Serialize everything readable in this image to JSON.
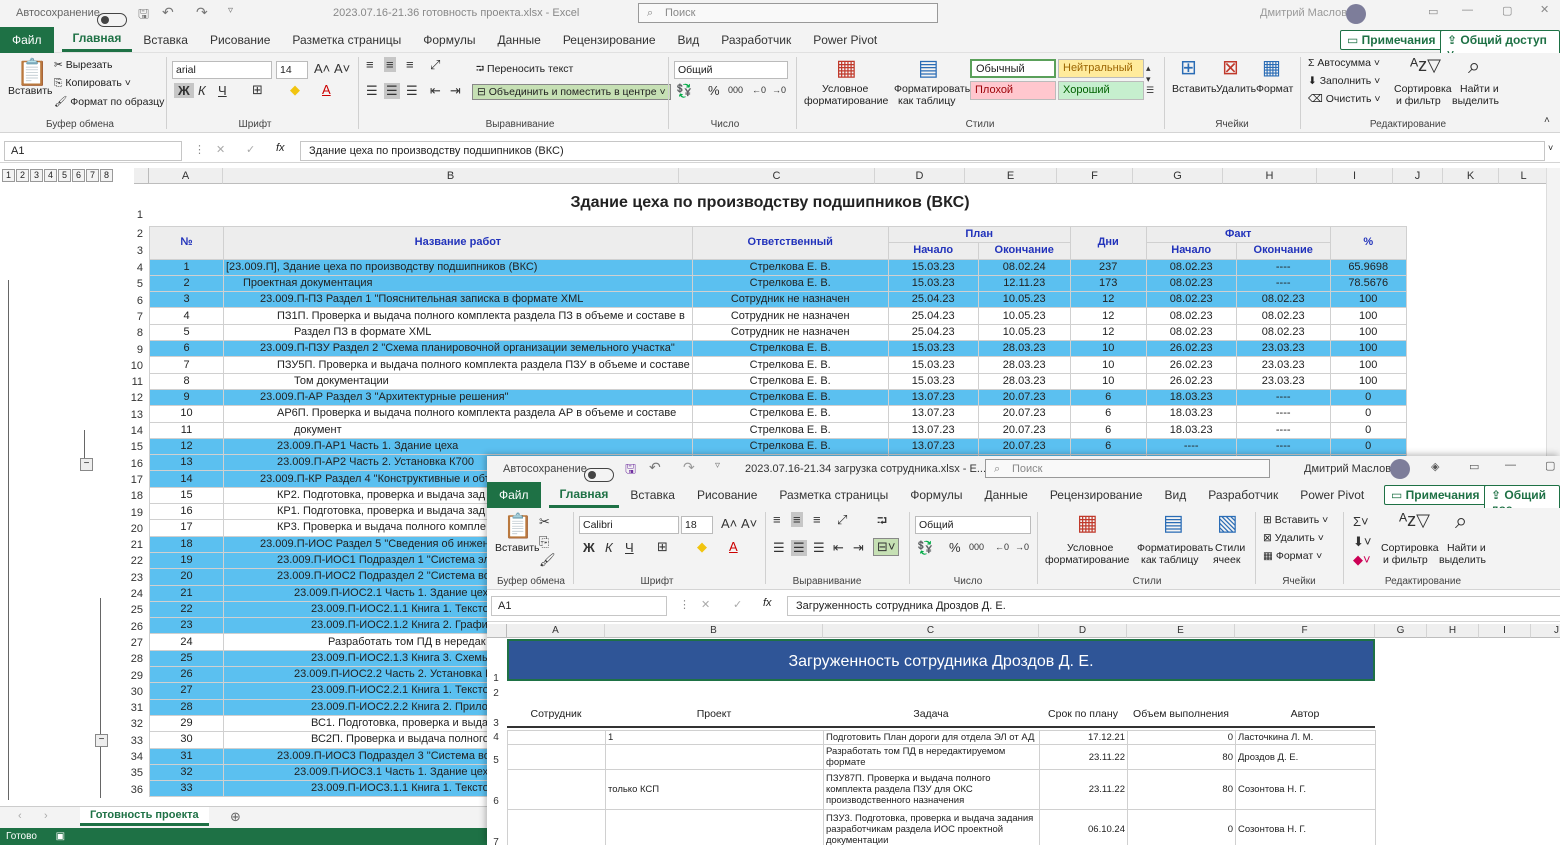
{
  "win1": {
    "autosave_label": "Автосохранение",
    "doc_title": "2023.07.16-21.36 готовность проекта.xlsx  -  Excel",
    "search_placeholder": "Поиск",
    "user_name": "Дмитрий Маслов",
    "menu": {
      "file": "Файл",
      "tabs": [
        "Главная",
        "Вставка",
        "Рисование",
        "Разметка страницы",
        "Формулы",
        "Данные",
        "Рецензирование",
        "Вид",
        "Разработчик",
        "Power Pivot"
      ],
      "comments": "Примечания",
      "share": "Общий доступ"
    },
    "ribbon": {
      "paste": "Вставить",
      "cut": "Вырезать",
      "copy": "Копировать",
      "format_painter": "Формат по образцу",
      "clipboard": "Буфер обмена",
      "font_name": "arial",
      "font_size": "14",
      "font": "Шрифт",
      "bold": "Ж",
      "italic": "К",
      "underline": "Ч",
      "wrap_text": "Переносить текст",
      "merge_center": "Объединить и поместить в центре",
      "alignment": "Выравнивание",
      "number_format": "Общий",
      "number": "Число",
      "conditional_line1": "Условное",
      "conditional_line2": "форматирование",
      "format_table_line1": "Форматировать",
      "format_table_line2": "как таблицу",
      "style_normal": "Обычный",
      "style_neutral": "Нейтральный",
      "style_bad": "Плохой",
      "style_good": "Хороший",
      "styles": "Стили",
      "insert": "Вставить",
      "delete": "Удалить",
      "format": "Формат",
      "cells": "Ячейки",
      "autosum": "Автосумма",
      "fill": "Заполнить",
      "clear": "Очистить",
      "sort_line1": "Сортировка",
      "sort_line2": "и фильтр",
      "find_line1": "Найти и",
      "find_line2": "выделить",
      "editing": "Редактирование"
    },
    "name_box": "A1",
    "formula": "Здание цеха по производству подшипников (ВКС)",
    "outline_levels": [
      "1",
      "2",
      "3",
      "4",
      "5",
      "6",
      "7",
      "8"
    ],
    "columns": [
      "A",
      "B",
      "C",
      "D",
      "E",
      "F",
      "G",
      "H",
      "I",
      "J",
      "K",
      "L"
    ],
    "sheet_title": "Здание цеха по производству подшипников (ВКС)",
    "headers": {
      "num": "№",
      "name": "Название работ",
      "resp": "Ответственный",
      "plan": "План",
      "fact": "Факт",
      "start": "Начало",
      "end": "Окончание",
      "days": "Дни",
      "pct": "%"
    },
    "rows": [
      {
        "r": "4",
        "n": "1",
        "name": "[23.009.П], Здание цеха по производству подшипников (ВКС)",
        "resp": "Стрелкова Е. В.",
        "ps": "15.03.23",
        "pe": "08.02.24",
        "d": "237",
        "fs": "08.02.23",
        "fe": "----",
        "p": "65.9698",
        "blue": true,
        "ind": 0
      },
      {
        "r": "5",
        "n": "2",
        "name": "Проектная документация",
        "resp": "Стрелкова Е. В.",
        "ps": "15.03.23",
        "pe": "12.11.23",
        "d": "173",
        "fs": "08.02.23",
        "fe": "----",
        "p": "78.5676",
        "blue": true,
        "ind": 1
      },
      {
        "r": "6",
        "n": "3",
        "name": "23.009.П-ПЗ Раздел 1 \"Пояснительная записка в формате XML",
        "resp": "Сотрудник не назначен",
        "ps": "25.04.23",
        "pe": "10.05.23",
        "d": "12",
        "fs": "08.02.23",
        "fe": "08.02.23",
        "p": "100",
        "blue": true,
        "ind": 2
      },
      {
        "r": "7",
        "n": "4",
        "name": "ПЗ1П. Проверка и выдача полного комплекта раздела ПЗ в объеме и составе в",
        "resp": "Сотрудник не назначен",
        "ps": "25.04.23",
        "pe": "10.05.23",
        "d": "12",
        "fs": "08.02.23",
        "fe": "08.02.23",
        "p": "100",
        "blue": false,
        "ind": 3
      },
      {
        "r": "8",
        "n": "5",
        "name": "Раздел ПЗ в формате XML",
        "resp": "Сотрудник не назначен",
        "ps": "25.04.23",
        "pe": "10.05.23",
        "d": "12",
        "fs": "08.02.23",
        "fe": "08.02.23",
        "p": "100",
        "blue": false,
        "ind": 4
      },
      {
        "r": "9",
        "n": "6",
        "name": "23.009.П-ПЗУ Раздел 2 \"Схема планировочной организации земельного участка\"",
        "resp": "Стрелкова Е. В.",
        "ps": "15.03.23",
        "pe": "28.03.23",
        "d": "10",
        "fs": "26.02.23",
        "fe": "23.03.23",
        "p": "100",
        "blue": true,
        "ind": 2
      },
      {
        "r": "10",
        "n": "7",
        "name": "ПЗУ5П. Проверка и выдача полного комплекта раздела ПЗУ в объеме и составе",
        "resp": "Стрелкова Е. В.",
        "ps": "15.03.23",
        "pe": "28.03.23",
        "d": "10",
        "fs": "26.02.23",
        "fe": "23.03.23",
        "p": "100",
        "blue": false,
        "ind": 3
      },
      {
        "r": "11",
        "n": "8",
        "name": "Том документации",
        "resp": "Стрелкова Е. В.",
        "ps": "15.03.23",
        "pe": "28.03.23",
        "d": "10",
        "fs": "26.02.23",
        "fe": "23.03.23",
        "p": "100",
        "blue": false,
        "ind": 4
      },
      {
        "r": "12",
        "n": "9",
        "name": "23.009.П-АР Раздел 3 \"Архитектурные решения\"",
        "resp": "Стрелкова Е. В.",
        "ps": "13.07.23",
        "pe": "20.07.23",
        "d": "6",
        "fs": "18.03.23",
        "fe": "----",
        "p": "0",
        "blue": true,
        "ind": 2
      },
      {
        "r": "13",
        "n": "10",
        "name": "АР6П. Проверка и выдача полного комплекта раздела АР в объеме и составе",
        "resp": "Стрелкова Е. В.",
        "ps": "13.07.23",
        "pe": "20.07.23",
        "d": "6",
        "fs": "18.03.23",
        "fe": "----",
        "p": "0",
        "blue": false,
        "ind": 3
      },
      {
        "r": "14",
        "n": "11",
        "name": "документ",
        "resp": "Стрелкова Е. В.",
        "ps": "13.07.23",
        "pe": "20.07.23",
        "d": "6",
        "fs": "18.03.23",
        "fe": "----",
        "p": "0",
        "blue": false,
        "ind": 4
      },
      {
        "r": "15",
        "n": "12",
        "name": "23.009.П-АР1 Часть 1. Здание цеха",
        "resp": "Стрелкова Е. В.",
        "ps": "13.07.23",
        "pe": "20.07.23",
        "d": "6",
        "fs": "----",
        "fe": "----",
        "p": "0",
        "blue": true,
        "ind": 3
      },
      {
        "r": "16",
        "n": "13",
        "name": "23.009.П-АР2 Часть 2. Установка К700",
        "resp": "",
        "ps": "",
        "pe": "",
        "d": "",
        "fs": "",
        "fe": "",
        "p": "",
        "blue": true,
        "ind": 3
      },
      {
        "r": "17",
        "n": "14",
        "name": "23.009.П-КР Раздел 4 \"Конструктивные и объ",
        "resp": "",
        "ps": "",
        "pe": "",
        "d": "",
        "fs": "",
        "fe": "",
        "p": "",
        "blue": true,
        "ind": 2
      },
      {
        "r": "18",
        "n": "15",
        "name": "КР2. Подготовка, проверка и выдача зад",
        "resp": "",
        "ps": "",
        "pe": "",
        "d": "",
        "fs": "",
        "fe": "",
        "p": "",
        "blue": false,
        "ind": 3
      },
      {
        "r": "19",
        "n": "16",
        "name": "КР1. Подготовка, проверка и выдача зад",
        "resp": "",
        "ps": "",
        "pe": "",
        "d": "",
        "fs": "",
        "fe": "",
        "p": "",
        "blue": false,
        "ind": 3
      },
      {
        "r": "20",
        "n": "17",
        "name": "КР3. Проверка и выдача полного компле",
        "resp": "",
        "ps": "",
        "pe": "",
        "d": "",
        "fs": "",
        "fe": "",
        "p": "",
        "blue": false,
        "ind": 3
      },
      {
        "r": "21",
        "n": "18",
        "name": "23.009.П-ИОС Раздел 5 \"Сведения об инжен",
        "resp": "",
        "ps": "",
        "pe": "",
        "d": "",
        "fs": "",
        "fe": "",
        "p": "",
        "blue": true,
        "ind": 2
      },
      {
        "r": "22",
        "n": "19",
        "name": "23.009.П-ИОС1 Подраздел 1 \"Система эл",
        "resp": "",
        "ps": "",
        "pe": "",
        "d": "",
        "fs": "",
        "fe": "",
        "p": "",
        "blue": true,
        "ind": 3
      },
      {
        "r": "23",
        "n": "20",
        "name": "23.009.П-ИОС2 Подраздел 2 \"Система во",
        "resp": "",
        "ps": "",
        "pe": "",
        "d": "",
        "fs": "",
        "fe": "",
        "p": "",
        "blue": true,
        "ind": 3
      },
      {
        "r": "24",
        "n": "21",
        "name": "23.009.П-ИОС2.1 Часть 1. Здание цеха",
        "resp": "",
        "ps": "",
        "pe": "",
        "d": "",
        "fs": "",
        "fe": "",
        "p": "",
        "blue": true,
        "ind": 4
      },
      {
        "r": "25",
        "n": "22",
        "name": "23.009.П-ИОС2.1.1 Книга 1. Текстов",
        "resp": "",
        "ps": "",
        "pe": "",
        "d": "",
        "fs": "",
        "fe": "",
        "p": "",
        "blue": true,
        "ind": 5
      },
      {
        "r": "26",
        "n": "23",
        "name": "23.009.П-ИОС2.1.2 Книга 2. Графич",
        "resp": "",
        "ps": "",
        "pe": "",
        "d": "",
        "fs": "",
        "fe": "",
        "p": "",
        "blue": true,
        "ind": 5
      },
      {
        "r": "27",
        "n": "24",
        "name": "Разработать том ПД в нередак",
        "resp": "",
        "ps": "",
        "pe": "",
        "d": "",
        "fs": "",
        "fe": "",
        "p": "",
        "blue": false,
        "ind": 6
      },
      {
        "r": "28",
        "n": "25",
        "name": "23.009.П-ИОС2.1.3 Книга 3. Схемы",
        "resp": "",
        "ps": "",
        "pe": "",
        "d": "",
        "fs": "",
        "fe": "",
        "p": "",
        "blue": true,
        "ind": 5
      },
      {
        "r": "29",
        "n": "26",
        "name": "23.009.П-ИОС2.2 Часть 2. Установка К",
        "resp": "",
        "ps": "",
        "pe": "",
        "d": "",
        "fs": "",
        "fe": "",
        "p": "",
        "blue": true,
        "ind": 4
      },
      {
        "r": "30",
        "n": "27",
        "name": "23.009.П-ИОС2.2.1 Книга 1. Текстов",
        "resp": "",
        "ps": "",
        "pe": "",
        "d": "",
        "fs": "",
        "fe": "",
        "p": "",
        "blue": true,
        "ind": 5
      },
      {
        "r": "31",
        "n": "28",
        "name": "23.009.П-ИОС2.2.2 Книга 2. Прилож",
        "resp": "",
        "ps": "",
        "pe": "",
        "d": "",
        "fs": "",
        "fe": "",
        "p": "",
        "blue": true,
        "ind": 5
      },
      {
        "r": "32",
        "n": "29",
        "name": "ВС1. Подготовка, проверка и выдача",
        "resp": "",
        "ps": "",
        "pe": "",
        "d": "",
        "fs": "",
        "fe": "",
        "p": "",
        "blue": false,
        "ind": 5
      },
      {
        "r": "33",
        "n": "30",
        "name": "ВС2П. Проверка и выдача полного ко",
        "resp": "",
        "ps": "",
        "pe": "",
        "d": "",
        "fs": "",
        "fe": "",
        "p": "",
        "blue": false,
        "ind": 5
      },
      {
        "r": "34",
        "n": "31",
        "name": "23.009.П-ИОС3 Подраздел 3 \"Система во",
        "resp": "",
        "ps": "",
        "pe": "",
        "d": "",
        "fs": "",
        "fe": "",
        "p": "",
        "blue": true,
        "ind": 3
      },
      {
        "r": "35",
        "n": "32",
        "name": "23.009.П-ИОС3.1 Часть 1. Здание цеха",
        "resp": "",
        "ps": "",
        "pe": "",
        "d": "",
        "fs": "",
        "fe": "",
        "p": "",
        "blue": true,
        "ind": 4
      },
      {
        "r": "36",
        "n": "33",
        "name": "23.009.П-ИОС3.1.1 Книга 1. Текстов",
        "resp": "",
        "ps": "",
        "pe": "",
        "d": "",
        "fs": "",
        "fe": "",
        "p": "",
        "blue": true,
        "ind": 5
      }
    ],
    "sheet_tab": "Готовность проекта",
    "status": "Готово"
  },
  "win2": {
    "autosave_label": "Автосохранение",
    "doc_title": "2023.07.16-21.34 загрузка сотрудника.xlsx  -  Е...",
    "search_placeholder": "Поиск",
    "user_name": "Дмитрий Маслов",
    "menu": {
      "file": "Файл",
      "tabs": [
        "Главная",
        "Вставка",
        "Рисование",
        "Разметка страницы",
        "Формулы",
        "Данные",
        "Рецензирование",
        "Вид",
        "Разработчик",
        "Power Pivot"
      ],
      "comments": "Примечания",
      "share": "Общий дос"
    },
    "ribbon": {
      "paste": "Вставить",
      "clipboard": "Буфер обмена",
      "font_name": "Calibri",
      "font_size": "18",
      "font": "Шрифт",
      "bold": "Ж",
      "italic": "К",
      "underline": "Ч",
      "alignment": "Выравнивание",
      "number_format": "Общий",
      "number": "Число",
      "conditional_line1": "Условное",
      "conditional_line2": "форматирование",
      "format_table_line1": "Форматировать",
      "format_table_line2": "как таблицу",
      "cell_styles_line1": "Стили",
      "cell_styles_line2": "ячеек",
      "styles": "Стили",
      "insert": "Вставить",
      "delete": "Удалить",
      "format": "Формат",
      "cells": "Ячейки",
      "sort_line1": "Сортировка",
      "sort_line2": "и фильтр",
      "find_line1": "Найти и",
      "find_line2": "выделить",
      "editing": "Редактирование"
    },
    "name_box": "A1",
    "formula": "Загруженность сотрудника Дроздов Д. Е.",
    "columns": [
      "A",
      "B",
      "C",
      "D",
      "E",
      "F",
      "G",
      "H",
      "I",
      "J"
    ],
    "banner": "Загруженность сотрудника Дроздов Д. Е.",
    "headers": {
      "employee": "Сотрудник",
      "project": "Проект",
      "task": "Задача",
      "due": "Срок по плану",
      "volume": "Объем выполнения",
      "author": "Автор"
    },
    "rows": [
      {
        "r": "4",
        "project": "1",
        "task": "Подготовить План дороги для отдела ЭЛ от АД",
        "due": "17.12.21",
        "vol": "0",
        "author": "Ласточкина Л. М."
      },
      {
        "r": "5",
        "project": "",
        "task": "Разработать том ПД в нередактируемом формате",
        "due": "23.11.22",
        "vol": "80",
        "author": "Дроздов Д. Е."
      },
      {
        "r": "6",
        "project": "только КСП",
        "task": "ПЗУ87П. Проверка и выдача полного комплекта раздела ПЗУ для ОКС производственного назначения",
        "due": "23.11.22",
        "vol": "80",
        "author": "Созонтова Н. Г."
      },
      {
        "r": "7",
        "project": "",
        "task": "ПЗУ3. Подготовка, проверка и выдача задания разработчикам раздела ИОС проектной документации",
        "due": "06.10.24",
        "vol": "0",
        "author": "Созонтова Н. Г."
      }
    ]
  }
}
